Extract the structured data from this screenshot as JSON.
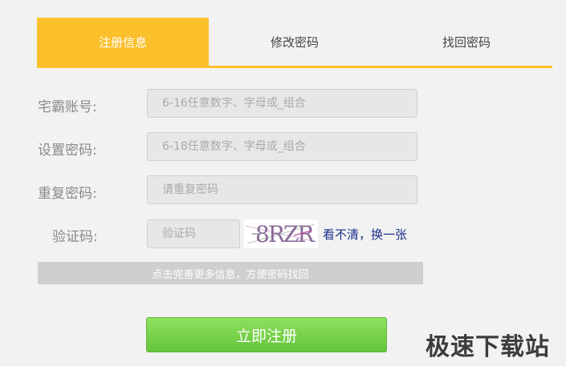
{
  "tabs": [
    {
      "label": "注册信息",
      "active": true
    },
    {
      "label": "修改密码",
      "active": false
    },
    {
      "label": "找回密码",
      "active": false
    }
  ],
  "form": {
    "account_label": "宅霸账号:",
    "account_placeholder": "6-16任意数字、字母或_组合",
    "password_label": "设置密码:",
    "password_placeholder": "6-18任意数字、字母或_组合",
    "repeat_label": "重复密码:",
    "repeat_placeholder": "请重复密码",
    "captcha_label": "验证码:",
    "captcha_placeholder": "验证码",
    "captcha_text": "8RZR",
    "captcha_refresh": "看不清，换一张"
  },
  "info_bar": "点击完善更多信息，方便密码找回",
  "submit_label": "立即注册",
  "watermark": "极速下载站",
  "colors": {
    "accent": "#fcc02d",
    "button_green": "#6cc940",
    "link_blue": "#1a2d8a"
  }
}
